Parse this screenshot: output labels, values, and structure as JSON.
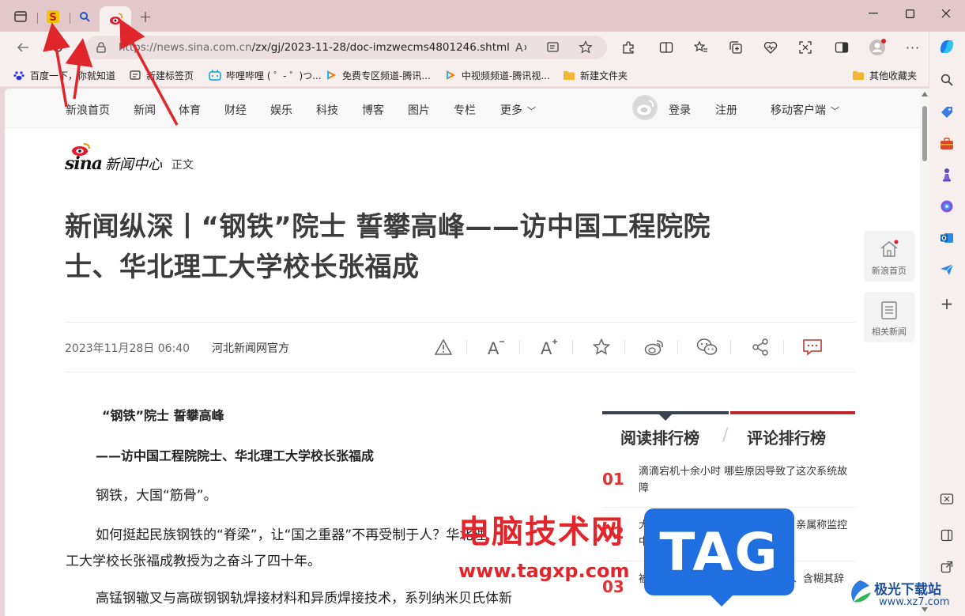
{
  "browser": {
    "new_tab_symbol": "+",
    "url_host": "https://news.sina.com.cn",
    "url_path": "/zx/gj/2023-11-28/doc-imzwecms4801246.shtml",
    "bookmarks": [
      {
        "label": "百度一下，你就知道",
        "icon": "baidu-icon"
      },
      {
        "label": "新建标签页",
        "icon": "new-tab-icon"
      },
      {
        "label": "哔哩哔哩 ( ゜- ゜)つ...",
        "icon": "bilibili-icon"
      },
      {
        "label": "免费专区频道-腾讯...",
        "icon": "tencent-video-icon"
      },
      {
        "label": "中视频频道-腾讯视...",
        "icon": "tencent-video-icon"
      },
      {
        "label": "新建文件夹",
        "icon": "folder-icon"
      }
    ],
    "other_bookmarks": "其他收藏夹"
  },
  "site_nav": {
    "items": [
      "新浪首页",
      "新闻",
      "体育",
      "财经",
      "娱乐",
      "科技",
      "博客",
      "图片",
      "专栏",
      "更多"
    ],
    "login": "登录",
    "register": "注册",
    "mobile": "移动客户端"
  },
  "brand": {
    "logo_text": "sina",
    "center": "新闻中心",
    "section": "正文"
  },
  "article": {
    "title_line1": "新闻纵深丨“钢铁”院士 誓攀高峰——访中国工程院院",
    "title_line2": "士、华北理工大学校长张福成",
    "date": "2023年11月28日 06:40",
    "source": "河北新闻网官方",
    "p1": "“钢铁”院士 誓攀高峰",
    "p2": "——访中国工程院院士、华北理工大学校长张福成",
    "p3": "钢铁，大国“筋骨”。",
    "p4": "如何挺起民族钢铁的“脊梁”，让“国之重器”不再受制于人？华北理",
    "p5": "工大学校长张福成教授为之奋斗了四十年。",
    "p6": "高锰钢辙叉与高碳钢钢轨焊接材料和异质焊接技术，系列纳米贝氏体新"
  },
  "floating": {
    "home": "新浪首页",
    "related": "相关新闻"
  },
  "ranking": {
    "tab_read": "阅读排行榜",
    "tab_divider": "/",
    "tab_comment": "评论排行榜",
    "items": [
      {
        "num": "01",
        "text": "滴滴宕机十余小时 哪些原因导致了这次系统故障"
      },
      {
        "num": "02",
        "text": "大学生跑山后猝死 坠崖者家属称：亲属称监控中看到异常 要求..."
      },
      {
        "num": "03",
        "text": "被要求拿出证据，美方却支支吾吾、含糊其辞"
      }
    ]
  },
  "watermarks": {
    "cn": "电脑技术网",
    "url": "www.tagxp.com",
    "tag": "TAG",
    "xz_cn": "极光下载站",
    "xz_url": "www.xz7.com"
  },
  "colors": {
    "sina_red": "#e6162d",
    "rank_red": "#d33333",
    "watermark_red": "#e3252b",
    "tag_blue": "#1f6fe0"
  }
}
